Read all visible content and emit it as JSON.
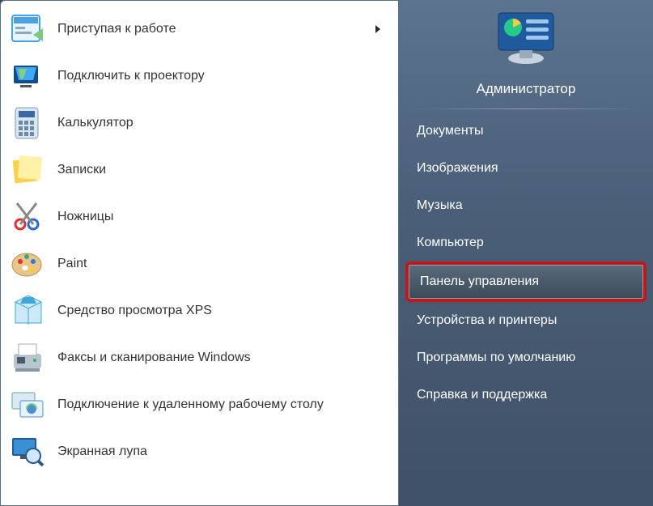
{
  "left": {
    "items": [
      {
        "label": "Приступая к работе",
        "has_submenu": true,
        "icon": "getting-started"
      },
      {
        "label": "Подключить к проектору",
        "has_submenu": false,
        "icon": "projector"
      },
      {
        "label": "Калькулятор",
        "has_submenu": false,
        "icon": "calculator"
      },
      {
        "label": "Записки",
        "has_submenu": false,
        "icon": "sticky-notes"
      },
      {
        "label": "Ножницы",
        "has_submenu": false,
        "icon": "snipping-tool"
      },
      {
        "label": "Paint",
        "has_submenu": false,
        "icon": "paint"
      },
      {
        "label": "Средство просмотра XPS",
        "has_submenu": false,
        "icon": "xps-viewer"
      },
      {
        "label": "Факсы и сканирование Windows",
        "has_submenu": false,
        "icon": "fax-scan"
      },
      {
        "label": "Подключение к удаленному рабочему столу",
        "has_submenu": false,
        "icon": "remote-desktop"
      },
      {
        "label": "Экранная лупа",
        "has_submenu": false,
        "icon": "magnifier"
      }
    ]
  },
  "right": {
    "user": "Администратор",
    "items": [
      {
        "label": "Документы",
        "highlighted": false
      },
      {
        "label": "Изображения",
        "highlighted": false
      },
      {
        "label": "Музыка",
        "highlighted": false
      },
      {
        "label": "Компьютер",
        "highlighted": false
      },
      {
        "label": "Панель управления",
        "highlighted": true
      },
      {
        "label": "Устройства и принтеры",
        "highlighted": false
      },
      {
        "label": "Программы по умолчанию",
        "highlighted": false
      },
      {
        "label": "Справка и поддержка",
        "highlighted": false
      }
    ]
  },
  "icons": {
    "getting-started": "#4aa3df",
    "projector": "#2b6fb5",
    "calculator": "#7a9bbd",
    "sticky-notes": "#f9d24a",
    "snipping-tool": "#d33",
    "paint": "#e0b060",
    "xps-viewer": "#3da7d9",
    "fax-scan": "#6a7a8a",
    "remote-desktop": "#4a8fd1",
    "magnifier": "#3a6fa5"
  }
}
